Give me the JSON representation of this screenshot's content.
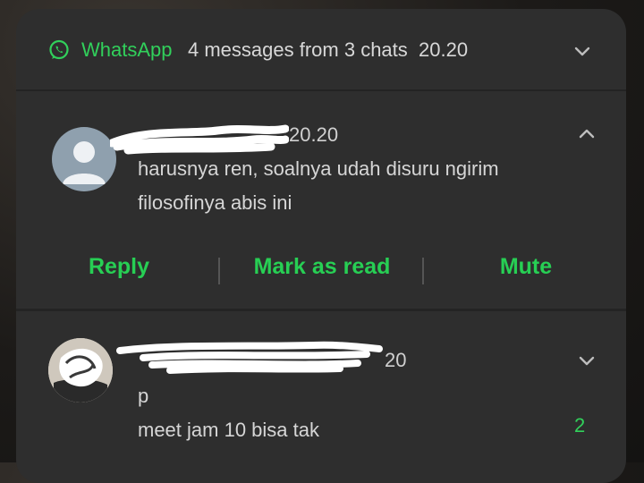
{
  "header": {
    "app_name": "WhatsApp",
    "summary": "4 messages from 3 chats",
    "time": "20.20",
    "icon": "whatsapp-icon",
    "accent": "#31d05b"
  },
  "notifications": [
    {
      "time": "20.20",
      "lines": [
        "harusnya ren, soalnya udah disuru ngirim",
        "filosofinya abis ini"
      ],
      "expanded": true
    },
    {
      "time_visible": "20",
      "lines": [
        "p",
        "meet jam 10 bisa tak"
      ],
      "unread_count": "2",
      "expanded": false
    }
  ],
  "actions": {
    "reply": "Reply",
    "mark_as_read": "Mark as read",
    "mute": "Mute"
  }
}
